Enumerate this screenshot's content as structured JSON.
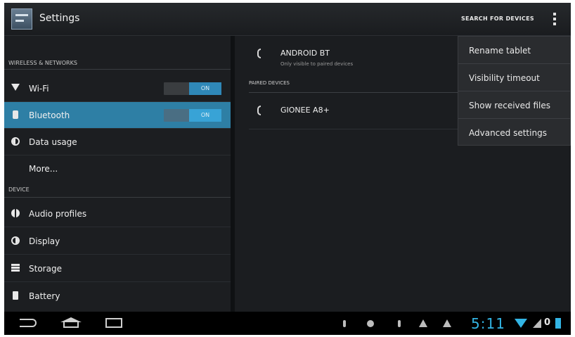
{
  "action_bar": {
    "title": "Settings",
    "search_label": "SEARCH FOR DEVICES",
    "overflow_icon": "overflow-menu-icon"
  },
  "sidebar": {
    "sections": [
      {
        "header": "WIRELESS & NETWORKS",
        "items": [
          {
            "label": "Wi-Fi",
            "icon": "wifi-icon",
            "toggle": "ON"
          },
          {
            "label": "Bluetooth",
            "icon": "bluetooth-icon",
            "toggle": "ON",
            "selected": true
          },
          {
            "label": "Data usage",
            "icon": "data-usage-icon"
          },
          {
            "label": "More..."
          }
        ]
      },
      {
        "header": "DEVICE",
        "items": [
          {
            "label": "Audio profiles",
            "icon": "audio-profiles-icon"
          },
          {
            "label": "Display",
            "icon": "display-icon"
          },
          {
            "label": "Storage",
            "icon": "storage-icon"
          },
          {
            "label": "Battery",
            "icon": "battery-icon"
          }
        ]
      }
    ]
  },
  "bluetooth": {
    "device": {
      "name": "ANDROID BT",
      "subtitle": "Only visible to paired devices"
    },
    "paired_header": "PAIRED DEVICES",
    "paired": [
      {
        "name": "GIONEE A8+"
      }
    ]
  },
  "menu": {
    "items": [
      "Rename tablet",
      "Visibility timeout",
      "Show received files",
      "Advanced settings"
    ]
  },
  "status_bar": {
    "time": "5:11",
    "battery_text": "0",
    "accent": "#33b5e5"
  }
}
